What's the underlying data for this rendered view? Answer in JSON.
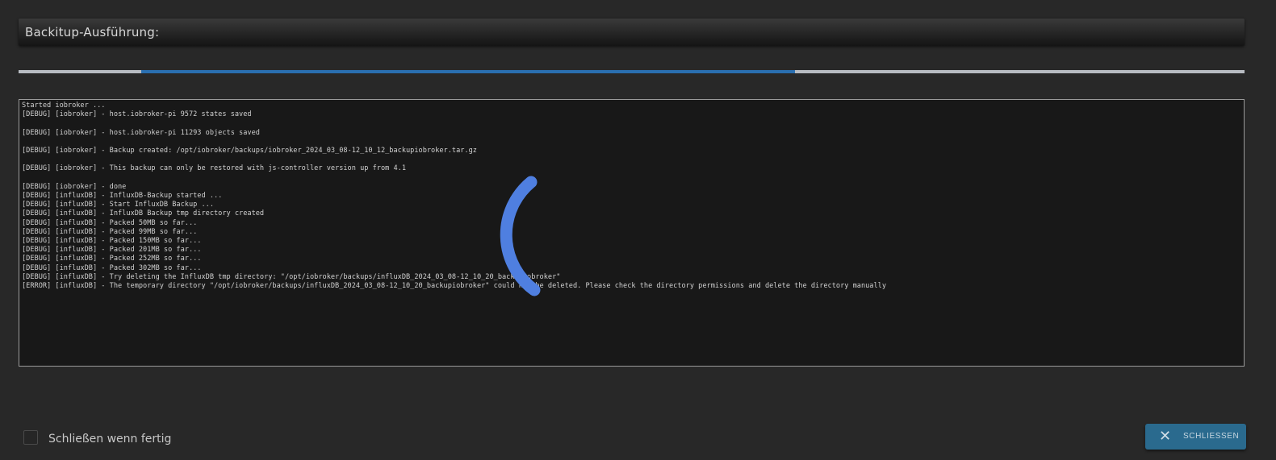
{
  "header": {
    "title": "Backitup-Ausführung:"
  },
  "progress": {
    "indeterminate": true,
    "segment_start_fraction": 0.1,
    "segment_end_fraction": 0.633,
    "color": "#2a6fb0"
  },
  "log": {
    "lines": [
      "Started iobroker ...",
      "[DEBUG] [iobroker] - host.iobroker-pi 9572 states saved",
      "",
      "[DEBUG] [iobroker] - host.iobroker-pi 11293 objects saved",
      "",
      "[DEBUG] [iobroker] - Backup created: /opt/iobroker/backups/iobroker_2024_03_08-12_10_12_backupiobroker.tar.gz",
      "",
      "[DEBUG] [iobroker] - This backup can only be restored with js-controller version up from 4.1",
      "",
      "[DEBUG] [iobroker] - done",
      "[DEBUG] [influxDB] - InfluxDB-Backup started ...",
      "[DEBUG] [influxDB] - Start InfluxDB Backup ...",
      "[DEBUG] [influxDB] - InfluxDB Backup tmp directory created",
      "[DEBUG] [influxDB] - Packed 50MB so far...",
      "[DEBUG] [influxDB] - Packed 99MB so far...",
      "[DEBUG] [influxDB] - Packed 150MB so far...",
      "[DEBUG] [influxDB] - Packed 201MB so far...",
      "[DEBUG] [influxDB] - Packed 252MB so far...",
      "[DEBUG] [influxDB] - Packed 302MB so far...",
      "[DEBUG] [influxDB] - Try deleting the InfluxDB tmp directory: \"/opt/iobroker/backups/influxDB_2024_03_08-12_10_20_backupiobroker\"",
      "[ERROR] [influxDB] - The temporary directory \"/opt/iobroker/backups/influxDB_2024_03_08-12_10_20_backupiobroker\" could not be deleted. Please check the directory permissions and delete the directory manually"
    ]
  },
  "spinner": {
    "icon": "loading-spinner-icon",
    "color": "#4f7fe0"
  },
  "footer": {
    "close_when_done_label": "Schließen wenn fertig",
    "close_when_done_checked": false,
    "close_button_label": "SCHLIESSEN",
    "close_icon": "close-icon"
  }
}
